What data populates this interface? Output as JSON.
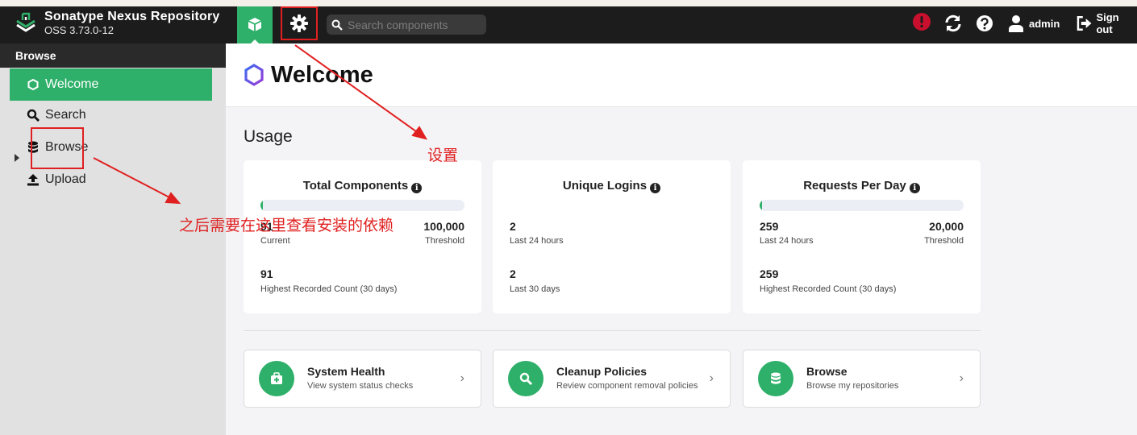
{
  "app": {
    "title": "Sonatype Nexus Repository",
    "version": "OSS 3.73.0-12"
  },
  "header": {
    "search_placeholder": "Search components",
    "user": "admin",
    "signout": "Sign out",
    "icons": [
      "browse-cube-icon",
      "gear-icon",
      "search-icon",
      "alert-icon",
      "refresh-icon",
      "help-icon",
      "user-icon",
      "signout-icon"
    ]
  },
  "sidebar": {
    "heading": "Browse",
    "items": [
      {
        "label": "Welcome",
        "icon": "hexagon-icon",
        "active": true
      },
      {
        "label": "Search",
        "icon": "search-icon",
        "active": false
      },
      {
        "label": "Browse",
        "icon": "database-icon",
        "active": false
      },
      {
        "label": "Upload",
        "icon": "upload-icon",
        "active": false
      }
    ]
  },
  "main": {
    "title": "Welcome",
    "usage_title": "Usage",
    "cards": [
      {
        "title": "Total Components",
        "progress": 0.0009,
        "current_value": "91",
        "current_label": "Current",
        "threshold_value": "100,000",
        "threshold_label": "Threshold",
        "peak_value": "91",
        "peak_label": "Highest Recorded Count (30 days)"
      },
      {
        "title": "Unique Logins",
        "a_value": "2",
        "a_label": "Last 24 hours",
        "b_value": "2",
        "b_label": "Last 30 days"
      },
      {
        "title": "Requests Per Day",
        "progress": 0.013,
        "current_value": "259",
        "current_label": "Last 24 hours",
        "threshold_value": "20,000",
        "threshold_label": "Threshold",
        "peak_value": "259",
        "peak_label": "Highest Recorded Count (30 days)"
      }
    ],
    "links": [
      {
        "title": "System Health",
        "desc": "View system status checks",
        "icon": "health-kit-icon"
      },
      {
        "title": "Cleanup Policies",
        "desc": "Review component removal policies",
        "icon": "search-icon"
      },
      {
        "title": "Browse",
        "desc": "Browse my repositories",
        "icon": "database-icon"
      }
    ]
  },
  "annotations": {
    "settings_note": "设置",
    "browse_note": "之后需要在这里查看安装的依赖",
    "color": "#e02020"
  },
  "colors": {
    "accent": "#2fb06a",
    "topbar": "#1c1c1c",
    "alert": "#c8102e"
  }
}
